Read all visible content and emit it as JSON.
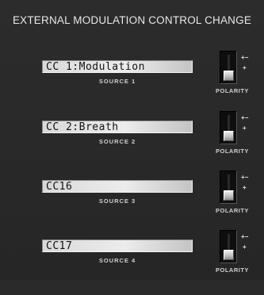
{
  "title": "EXTERNAL MODULATION CONTROL CHANGE",
  "polarity_label": "POLARITY",
  "polarity_symbols": {
    "bipolar": "+−",
    "unipolar": "+"
  },
  "rows": [
    {
      "value": "CC 1:Modulation",
      "source": "SOURCE 1"
    },
    {
      "value": "CC 2:Breath",
      "source": "SOURCE 2"
    },
    {
      "value": "CC16",
      "source": "SOURCE 3"
    },
    {
      "value": "CC17",
      "source": "SOURCE 4"
    }
  ]
}
